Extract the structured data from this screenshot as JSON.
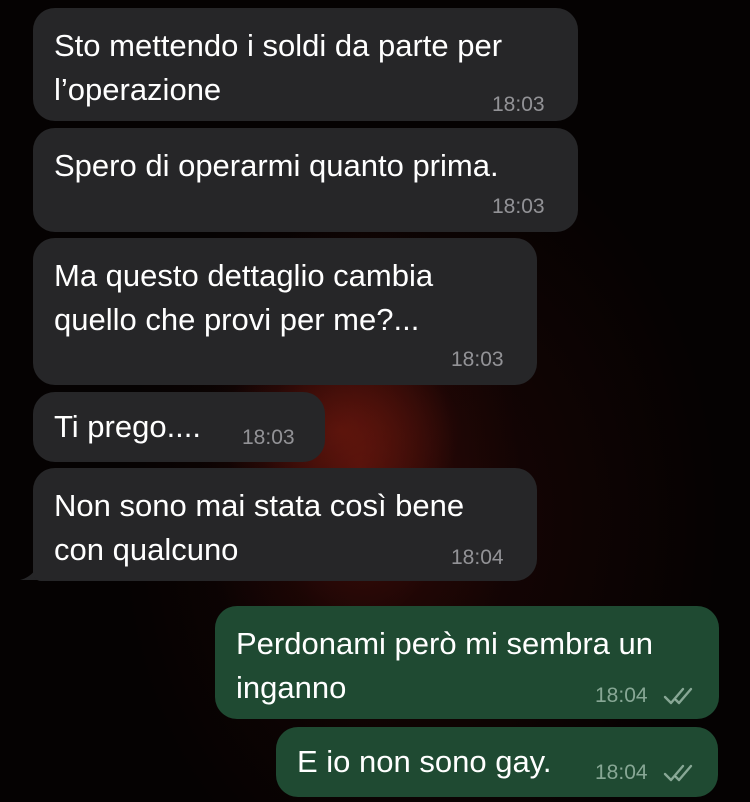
{
  "messages": [
    {
      "id": "m1",
      "direction": "incoming",
      "text": "Sto mettendo i soldi da parte per\nl’operazione",
      "time": "18:03"
    },
    {
      "id": "m2",
      "direction": "incoming",
      "text": "Spero di operarmi quanto prima.",
      "time": "18:03"
    },
    {
      "id": "m3",
      "direction": "incoming",
      "text": "Ma questo dettaglio cambia\nquello che provi per me?...",
      "time": "18:03"
    },
    {
      "id": "m4",
      "direction": "incoming",
      "text": "Ti prego....",
      "time": "18:03"
    },
    {
      "id": "m5",
      "direction": "incoming",
      "text": "Non sono mai stata così bene\ncon qualcuno",
      "time": "18:04"
    },
    {
      "id": "m6",
      "direction": "outgoing",
      "text": "Perdonami però mi sembra un\ninganno",
      "time": "18:04",
      "status_icon": "double-check-icon"
    },
    {
      "id": "m7",
      "direction": "outgoing",
      "text": "E io non sono gay.",
      "time": "18:04",
      "status_icon": "double-check-icon"
    }
  ],
  "colors": {
    "incoming_bubble": "#262628",
    "outgoing_bubble": "#1f4a32",
    "background": "#050202"
  }
}
